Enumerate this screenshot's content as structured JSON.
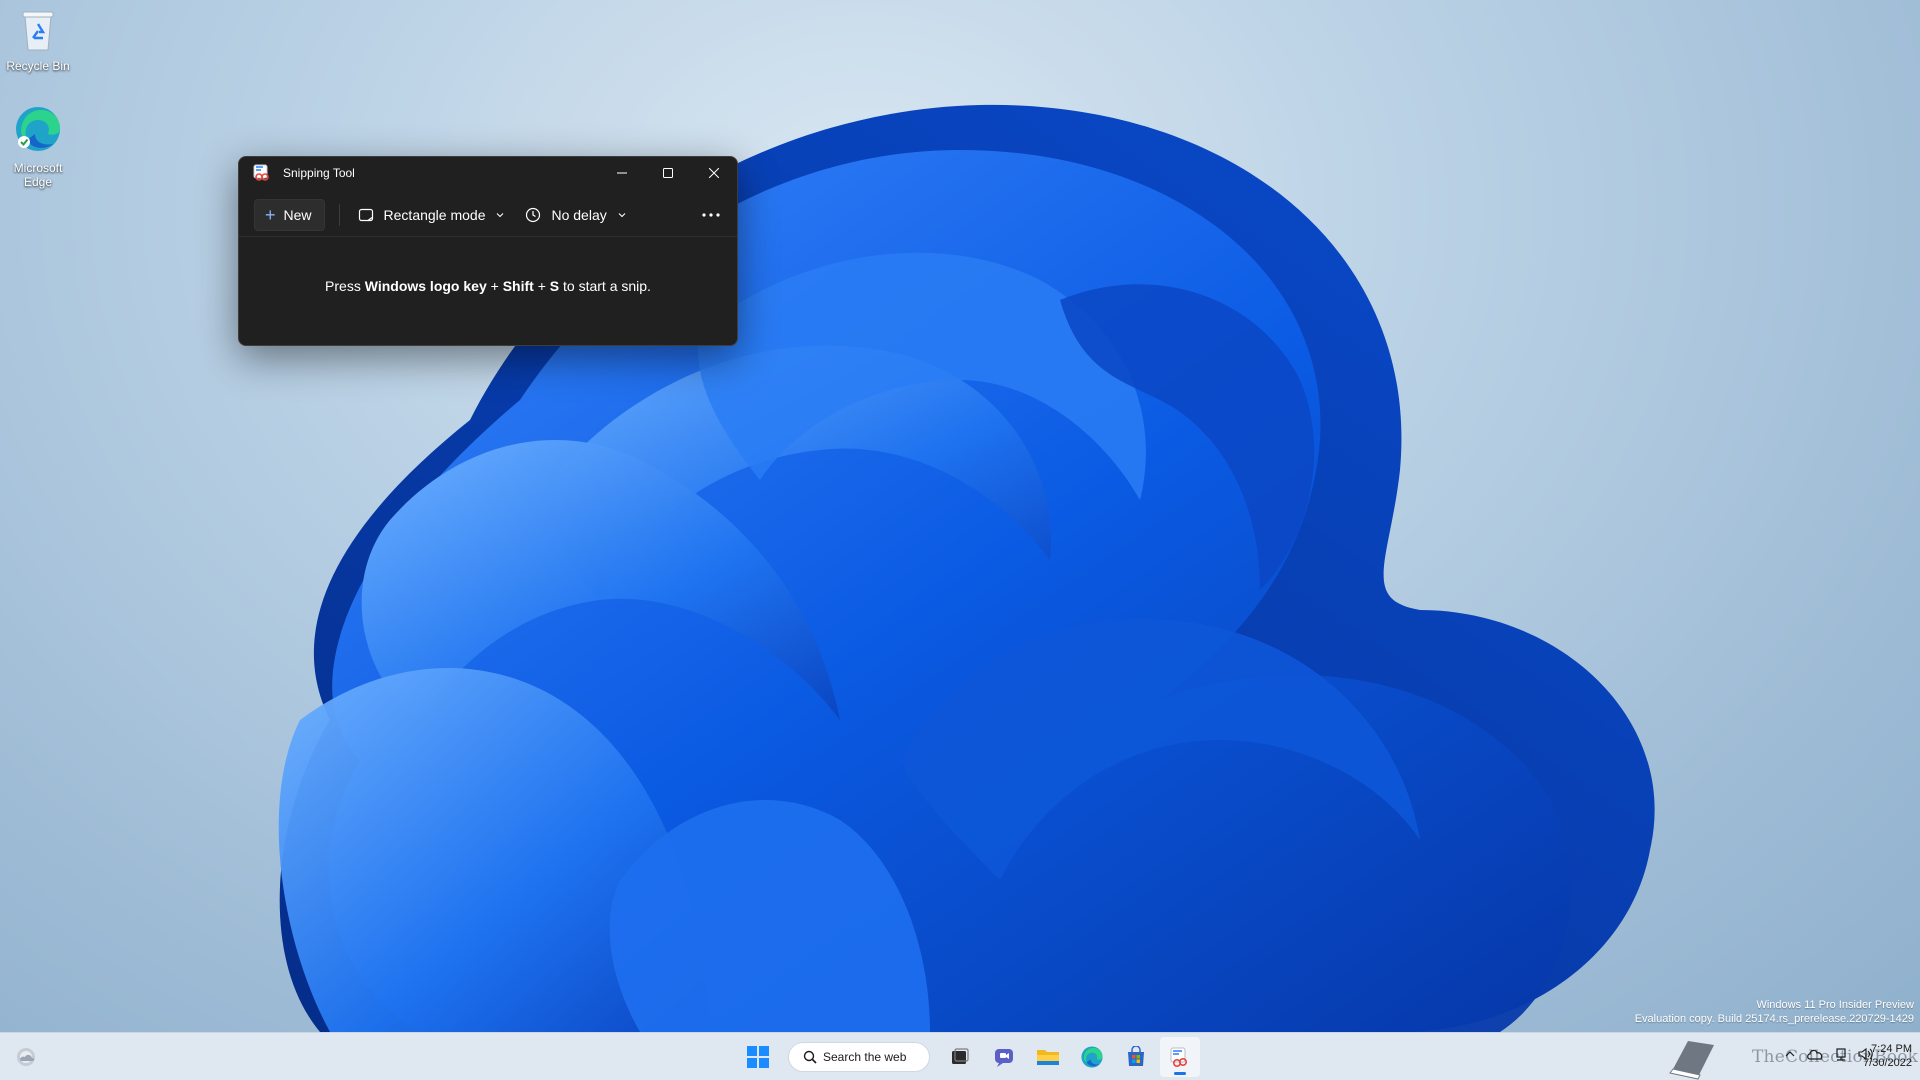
{
  "desktop": {
    "icons": [
      {
        "label": "Recycle Bin",
        "icon": "recycle-bin-icon"
      },
      {
        "label": "Microsoft Edge",
        "icon": "edge-icon"
      }
    ]
  },
  "snipping_tool": {
    "title": "Snipping Tool",
    "new_label": "New",
    "mode_label": "Rectangle mode",
    "delay_label": "No delay",
    "hint_prefix": "Press ",
    "hint_bold1": "Windows logo key",
    "hint_mid1": " + ",
    "hint_bold2": "Shift",
    "hint_mid2": " + ",
    "hint_bold3": "S",
    "hint_suffix": " to start a snip."
  },
  "watermark": {
    "line1": "Windows 11 Pro Insider Preview",
    "line2": "Evaluation copy. Build 25174.rs_prerelease.220729-1429"
  },
  "taskbar": {
    "search_label": "Search the web",
    "apps": [
      "start-icon",
      "search",
      "task-view-icon",
      "chat-icon",
      "file-explorer-icon",
      "edge-icon",
      "store-icon",
      "snipping-tool-icon"
    ],
    "active_app": "snipping-tool-icon",
    "brand_overlay": "TheCollectionBook",
    "clock_time": "7:24 PM",
    "clock_date": "7/30/2022"
  },
  "colors": {
    "accent": "#1a73e8",
    "window_bg": "#202020",
    "taskbar_bg": "#dfe8f1"
  }
}
